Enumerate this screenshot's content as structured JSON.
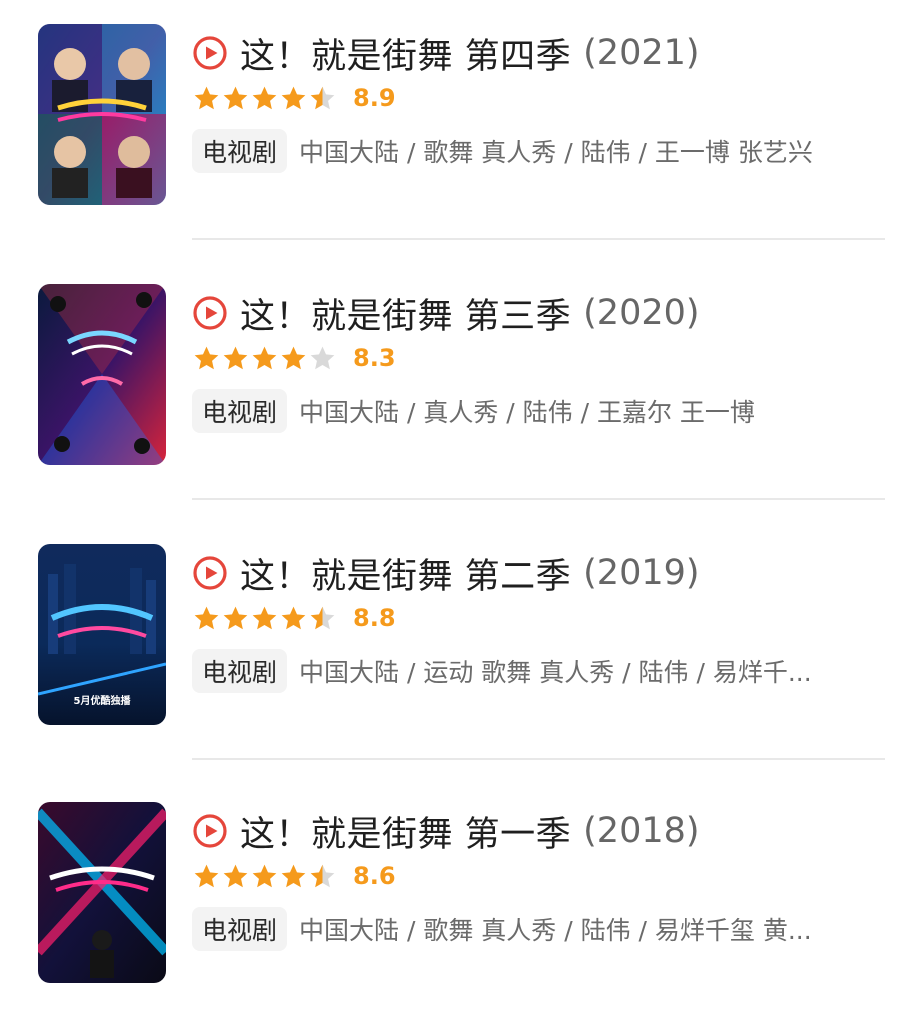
{
  "items": [
    {
      "title": "这！就是街舞 第四季",
      "year": "(2021)",
      "rating": "8.9",
      "stars": 4.5,
      "tag": "电视剧",
      "meta": "中国大陆 / 歌舞 真人秀 / 陆伟 / 王一博 张艺兴",
      "poster_colors": [
        "#2c1b59",
        "#0f9ad8",
        "#e0249a"
      ]
    },
    {
      "title": "这！就是街舞 第三季",
      "year": "(2020)",
      "rating": "8.3",
      "stars": 4,
      "tag": "电视剧",
      "meta": "中国大陆 / 真人秀 / 陆伟 / 王嘉尔 王一博",
      "poster_colors": [
        "#0b1a3a",
        "#1e90ff",
        "#ff3b30"
      ]
    },
    {
      "title": "这！就是街舞 第二季",
      "year": "(2019)",
      "rating": "8.8",
      "stars": 4.5,
      "tag": "电视剧",
      "meta": "中国大陆 / 运动 歌舞 真人秀 / 陆伟 / 易烊千...",
      "poster_colors": [
        "#0b1c3d",
        "#2b7bff",
        "#ff2e88"
      ],
      "poster_caption": "5月优酷独播"
    },
    {
      "title": "这！就是街舞 第一季",
      "year": "(2018)",
      "rating": "8.6",
      "stars": 4.5,
      "tag": "电视剧",
      "meta": "中国大陆 / 歌舞 真人秀 / 陆伟 / 易烊千玺 黄...",
      "poster_colors": [
        "#1a0d2a",
        "#00c2ff",
        "#ff1f6d"
      ]
    }
  ],
  "colors": {
    "star_filled": "#f59a1c",
    "star_empty": "#d9d9d9",
    "play_icon": "#e5463b",
    "divider": "#e8e8e8"
  },
  "icons": {
    "play": "play-circle-icon",
    "star": "star-icon"
  }
}
